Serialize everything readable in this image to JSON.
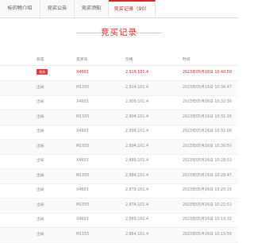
{
  "tabs": [
    {
      "label": "标的物介绍"
    },
    {
      "label": "竞买公告"
    },
    {
      "label": "竞买须知"
    },
    {
      "label": "竞买记录（90）"
    }
  ],
  "section_title": "竞买记录",
  "columns": {
    "status": "状态",
    "bid_no": "竞买号",
    "price": "价格",
    "time": "时间"
  },
  "rows": [
    {
      "status": "领先",
      "bid_no": "X4603",
      "price": "2,919,101.4",
      "time": "2023年05月16日 10:40:50"
    },
    {
      "status": "出局",
      "bid_no": "M1555",
      "price": "2,914,101.4",
      "time": "2023年05月16日 10:36:47"
    },
    {
      "status": "出局",
      "bid_no": "X4603",
      "price": "2,909,101.4",
      "time": "2023年05月16日 10:32:36"
    },
    {
      "status": "出局",
      "bid_no": "M1555",
      "price": "2,904,101.4",
      "time": "2023年05月16日 10:31:26"
    },
    {
      "status": "出局",
      "bid_no": "X4603",
      "price": "2,899,101.4",
      "time": "2023年05月16日 10:31:00"
    },
    {
      "status": "出局",
      "bid_no": "M1555",
      "price": "2,894,101.4",
      "time": "2023年05月16日 10:30:50"
    },
    {
      "status": "出局",
      "bid_no": "X4603",
      "price": "2,889,101.4",
      "time": "2023年05月16日 10:28:53"
    },
    {
      "status": "出局",
      "bid_no": "M1555",
      "price": "2,884,101.4",
      "time": "2023年05月16日 10:28:47"
    },
    {
      "status": "出局",
      "bid_no": "X4603",
      "price": "2,879,101.4",
      "time": "2023年05月16日 10:25:15"
    },
    {
      "status": "出局",
      "bid_no": "M1555",
      "price": "2,874,101.4",
      "time": "2023年05月16日 10:22:53"
    },
    {
      "status": "出局",
      "bid_no": "X4603",
      "price": "2,869,101.4",
      "time": "2023年05月16日 10:19:32"
    },
    {
      "status": "出局",
      "bid_no": "M1555",
      "price": "2,864,101.4",
      "time": "2023年05月16日 10:15:56"
    }
  ],
  "colors": {
    "accent": "#d9251c",
    "badge": "#e5363a"
  }
}
